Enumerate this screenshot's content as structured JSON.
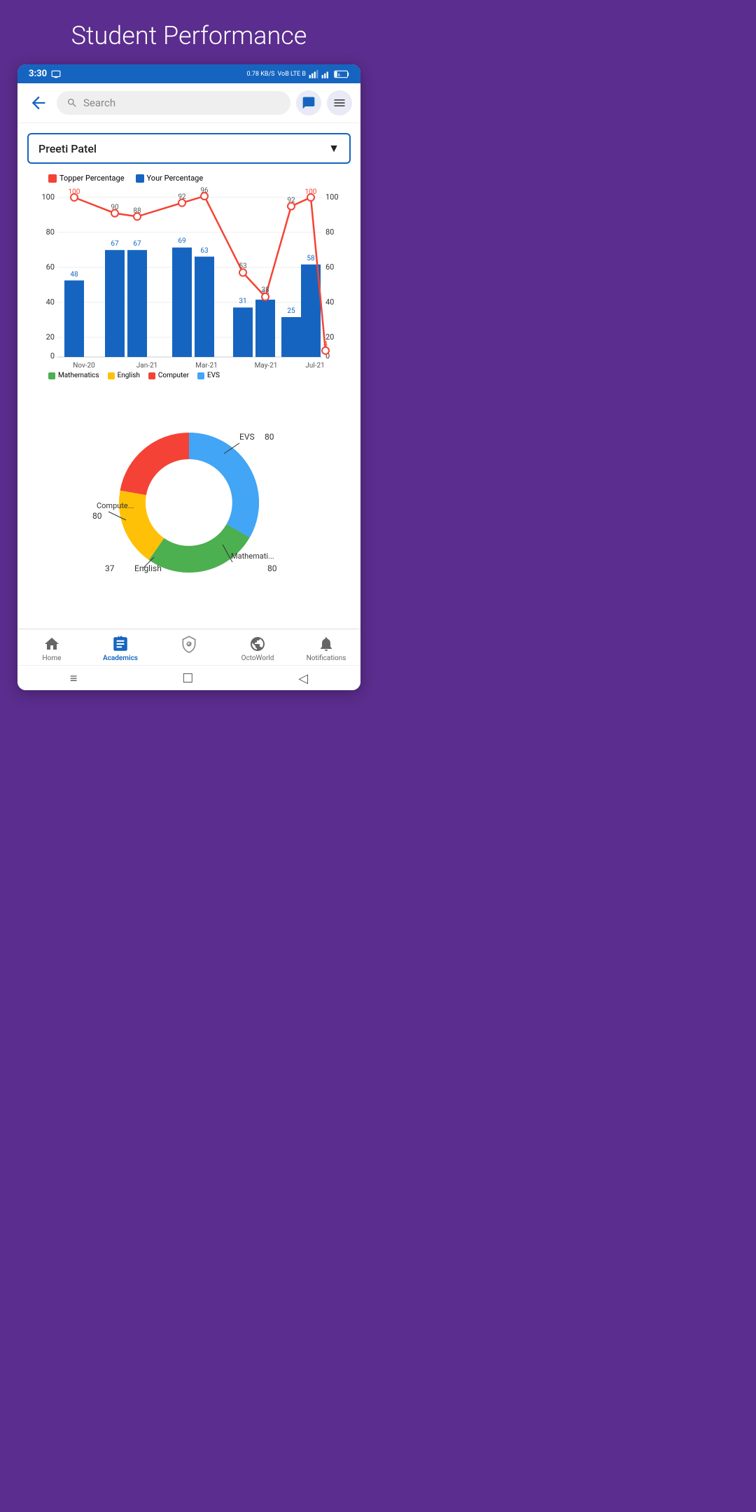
{
  "page": {
    "title": "Student Performance",
    "background_color": "#5b2d8e"
  },
  "status_bar": {
    "time": "3:30",
    "network_speed": "0.78 KB/S",
    "network_type": "4G",
    "battery_level": "6"
  },
  "toolbar": {
    "search_placeholder": "Search",
    "back_label": "Back"
  },
  "dropdown": {
    "selected": "Preeti Patel"
  },
  "chart": {
    "legend": {
      "topper": "Topper Percentage",
      "yours": "Your Percentage"
    },
    "months": [
      "Nov-20",
      "Jan-21",
      "Mar-21",
      "May-21",
      "Jul-21"
    ],
    "bars": [
      {
        "month": "Nov-20",
        "value": 48,
        "topper": 100
      },
      {
        "month": "Jan-21",
        "value": 67,
        "topper": 90
      },
      {
        "month": "Jan-21b",
        "value": 67,
        "topper": 88
      },
      {
        "month": "Mar-21a",
        "value": 69,
        "topper": 92
      },
      {
        "month": "Mar-21b",
        "value": 63,
        "topper": 96
      },
      {
        "month": "May-21a",
        "value": 31,
        "topper": 53
      },
      {
        "month": "May-21b",
        "value": 36,
        "topper": 38
      },
      {
        "month": "Jul-21a",
        "value": 25,
        "topper": 92
      },
      {
        "month": "Jul-21b",
        "value": 58,
        "topper": 100
      },
      {
        "month": "Jul-21c",
        "value": 4,
        "topper": 4
      }
    ],
    "bottom_legend": [
      "Mathematics",
      "English",
      "Computer",
      "EVS"
    ],
    "bottom_colors": [
      "#4caf50",
      "#ffc107",
      "#f44336",
      "#42a5f5"
    ]
  },
  "donut_chart": {
    "segments": [
      {
        "label": "EVS",
        "value": 80,
        "color": "#42a5f5",
        "angle_start": 0,
        "angle_end": 120
      },
      {
        "label": "Mathematics",
        "value": 80,
        "color": "#4caf50",
        "angle_start": 120,
        "angle_end": 215
      },
      {
        "label": "English",
        "value": 37,
        "color": "#ffc107",
        "angle_start": 215,
        "angle_end": 260
      },
      {
        "label": "Computer",
        "value": 80,
        "color": "#f44336",
        "angle_start": 260,
        "angle_end": 360
      }
    ],
    "labels": [
      {
        "text": "EVS",
        "value": "80",
        "position": "top-right"
      },
      {
        "text": "Mathematics",
        "value": "80",
        "position": "bottom-right"
      },
      {
        "text": "English",
        "value": "37",
        "position": "bottom-left"
      },
      {
        "text": "Computer",
        "value": "80",
        "position": "left"
      }
    ]
  },
  "bottom_nav": {
    "items": [
      {
        "label": "Home",
        "active": false,
        "icon": "home"
      },
      {
        "label": "Academics",
        "active": true,
        "icon": "academics"
      },
      {
        "label": "",
        "active": false,
        "icon": "plus-shield"
      },
      {
        "label": "OctoWorld",
        "active": false,
        "icon": "globe"
      },
      {
        "label": "Notifications",
        "active": false,
        "icon": "bell"
      }
    ]
  }
}
